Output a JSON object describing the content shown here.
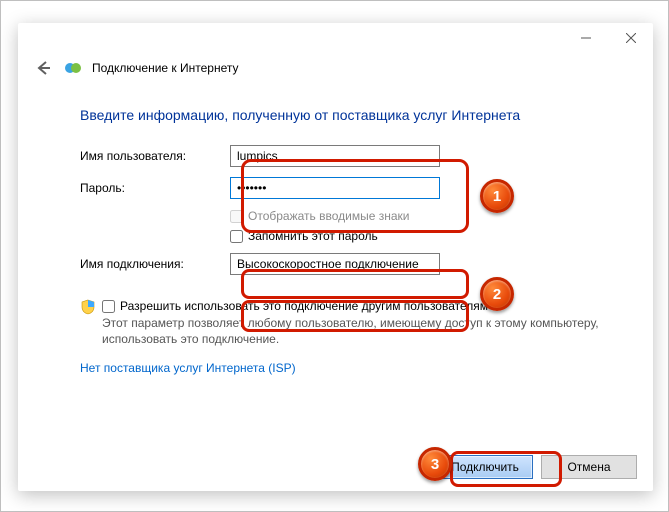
{
  "window": {
    "title": "Подключение к Интернету"
  },
  "instruction": "Введите информацию, полученную от поставщика услуг Интернета",
  "labels": {
    "username": "Имя пользователя:",
    "password": "Пароль:",
    "conn_name": "Имя подключения:"
  },
  "values": {
    "username": "lumpics",
    "password": "•••••••",
    "conn_name": "Высокоскоростное подключение"
  },
  "checks": {
    "show_chars": "Отображать вводимые знаки",
    "remember": "Запомнить этот пароль"
  },
  "share": {
    "label": "Разрешить использовать это подключение другим пользователям",
    "desc": "Этот параметр позволяет любому пользователю, имеющему доступ к этому компьютеру, использовать это подключение."
  },
  "link": "Нет поставщика услуг Интернета (ISP)",
  "buttons": {
    "connect": "Подключить",
    "cancel": "Отмена"
  },
  "badges": {
    "b1": "1",
    "b2": "2",
    "b3": "3"
  }
}
